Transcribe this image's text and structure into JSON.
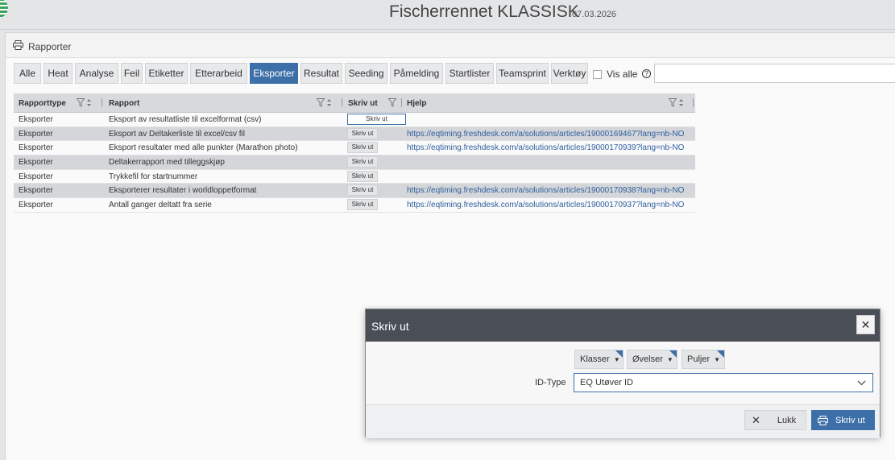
{
  "app": {
    "title": "Fischerrennet KLASSISK",
    "date": "07.03.2026"
  },
  "panel": {
    "title": "Rapporter"
  },
  "tabs": [
    "Alle",
    "Heat",
    "Analyse",
    "Feil",
    "Etiketter",
    "Etterarbeid",
    "Eksporter",
    "Resultat",
    "Seeding",
    "Påmelding",
    "Startlister",
    "Teamsprint",
    "Verktøy"
  ],
  "active_tab": "Eksporter",
  "vis_alle": "Vis alle",
  "search": {
    "value": "",
    "placeholder": ""
  },
  "grid": {
    "columns": [
      "Rapporttype",
      "Rapport",
      "Skriv ut",
      "Hjelp"
    ],
    "rows": [
      {
        "type": "Eksporter",
        "report": "Eksport av resultatliste til excelformat (csv)",
        "print": "Skriv ut",
        "help": ""
      },
      {
        "type": "Eksporter",
        "report": "Eksport av Deltakerliste til excel/csv fil",
        "print": "Skriv ut",
        "help": "https://eqtiming.freshdesk.com/a/solutions/articles/19000169467?lang=nb-NO"
      },
      {
        "type": "Eksporter",
        "report": "Eksport resultater med alle punkter (Marathon photo)",
        "print": "Skriv ut",
        "help": "https://eqtiming.freshdesk.com/a/solutions/articles/19000170939?lang=nb-NO"
      },
      {
        "type": "Eksporter",
        "report": "Deltakerrapport med tilleggskjøp",
        "print": "Skriv ut",
        "help": ""
      },
      {
        "type": "Eksporter",
        "report": "Trykkefil for startnummer",
        "print": "Skriv ut",
        "help": ""
      },
      {
        "type": "Eksporter",
        "report": "Eksporterer resultater i worldloppetformat",
        "print": "Skriv ut",
        "help": "https://eqtiming.freshdesk.com/a/solutions/articles/19000170938?lang=nb-NO"
      },
      {
        "type": "Eksporter",
        "report": "Antall ganger deltatt fra serie",
        "print": "Skriv ut",
        "help": "https://eqtiming.freshdesk.com/a/solutions/articles/19000170937?lang=nb-NO"
      }
    ]
  },
  "dialog": {
    "title": "Skriv ut",
    "chips": [
      "Klasser",
      "Øvelser",
      "Puljer"
    ],
    "id_type_label": "ID-Type",
    "id_type_value": "EQ Utøver ID",
    "close_label": "Lukk",
    "print_label": "Skriv ut"
  },
  "colors": {
    "accent": "#3d6fa8",
    "dialog_header": "#4a4f57",
    "link": "#2f5f9e"
  },
  "icons": [
    "logo-icon",
    "printer-icon",
    "filter-icon",
    "sort-icon",
    "help-icon",
    "chevron-down-icon",
    "close-icon"
  ]
}
